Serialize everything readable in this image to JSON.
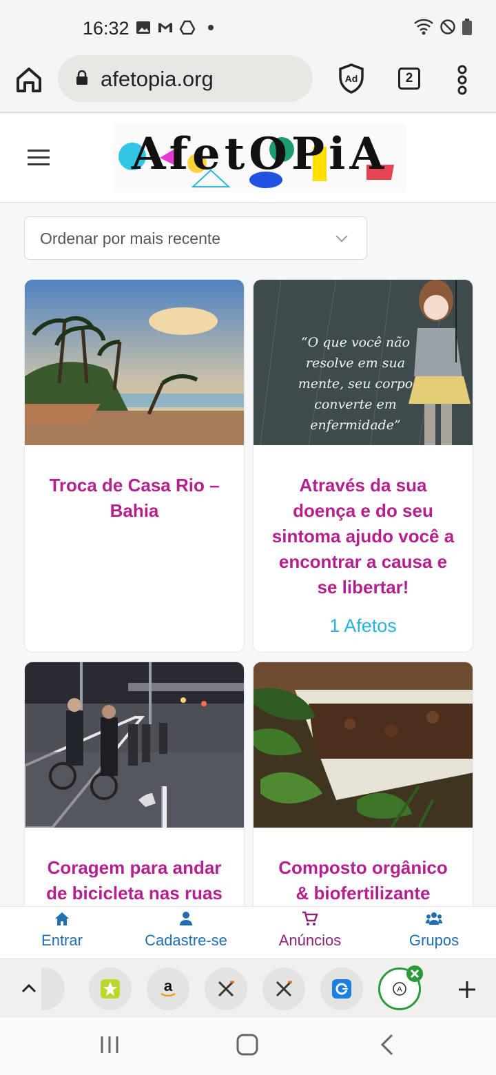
{
  "status_bar": {
    "time": "16:32"
  },
  "browser": {
    "url": "afetopia.org",
    "tab_count": "2"
  },
  "site": {
    "logo_text": "AfetOPiA"
  },
  "sort": {
    "selected": "Ordenar por mais recente"
  },
  "cards": [
    {
      "title": "Troca de Casa Rio – Bahia",
      "meta": ""
    },
    {
      "title": "Através da sua doença e do seu sintoma ajudo você a encontrar a causa e se libertar!",
      "meta": "1 Afetos",
      "image_quote": "“O que você não resolve em sua mente, seu corpo converte em enfermidade”"
    },
    {
      "title": "Coragem para andar de bicicleta nas ruas",
      "meta": ""
    },
    {
      "title": "Composto orgânico & biofertilizante",
      "meta": ""
    }
  ],
  "site_nav": {
    "items": [
      {
        "label": "Entrar",
        "icon": "home-icon"
      },
      {
        "label": "Cadastre-se",
        "icon": "user-icon"
      },
      {
        "label": "Anúncios",
        "icon": "cart-icon"
      },
      {
        "label": "Grupos",
        "icon": "users-icon"
      }
    ]
  },
  "colors": {
    "card_title": "#b5208f",
    "meta": "#29b4dd",
    "nav_blue": "#1f6fb2",
    "nav_purple": "#8e2477"
  }
}
